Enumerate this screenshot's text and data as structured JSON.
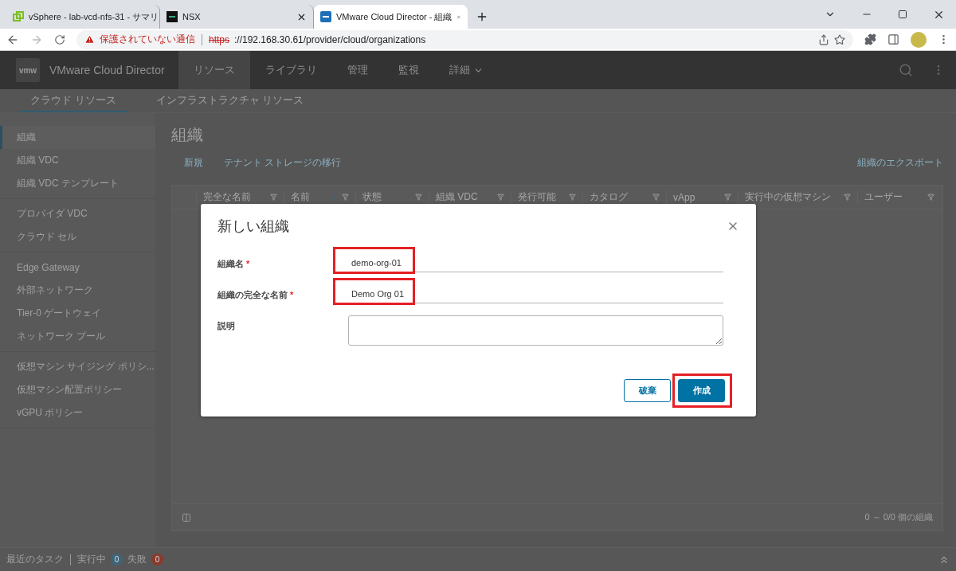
{
  "browser": {
    "tabs": [
      {
        "title": "vSphere - lab-vcd-nfs-31 - サマリ",
        "kind": "vsphere",
        "selected": false
      },
      {
        "title": "NSX",
        "kind": "nsx",
        "selected": false
      },
      {
        "title": "VMware Cloud Director - 組織",
        "kind": "vmw",
        "selected": true
      }
    ],
    "security_warning": "保護されていない通信",
    "url_scheme": "https",
    "url_rest": "://192.168.30.61/provider/cloud/organizations"
  },
  "app": {
    "logo_text": "vmw",
    "product": "VMware Cloud Director",
    "nav": [
      {
        "label": "リソース",
        "selected": true,
        "dropdown": false
      },
      {
        "label": "ライブラリ",
        "selected": false,
        "dropdown": false
      },
      {
        "label": "管理",
        "selected": false,
        "dropdown": false
      },
      {
        "label": "監視",
        "selected": false,
        "dropdown": false
      },
      {
        "label": "詳細",
        "selected": false,
        "dropdown": true
      }
    ],
    "subtabs": [
      {
        "label": "クラウド リソース",
        "selected": true
      },
      {
        "label": "インフラストラクチャ リソース",
        "selected": false
      }
    ]
  },
  "sidebar": {
    "groups": [
      {
        "items": [
          {
            "label": "組織",
            "selected": true
          },
          {
            "label": "組織 VDC",
            "selected": false
          },
          {
            "label": "組織 VDC テンプレート",
            "selected": false
          }
        ]
      },
      {
        "items": [
          {
            "label": "プロバイダ VDC",
            "selected": false
          },
          {
            "label": "クラウド セル",
            "selected": false
          }
        ]
      },
      {
        "items": [
          {
            "label": "Edge Gateway",
            "selected": false
          },
          {
            "label": "外部ネットワーク",
            "selected": false
          },
          {
            "label": "Tier-0 ゲートウェイ",
            "selected": false
          },
          {
            "label": "ネットワーク プール",
            "selected": false
          }
        ]
      },
      {
        "items": [
          {
            "label": "仮想マシン サイジング ポリシ...",
            "selected": false
          },
          {
            "label": "仮想マシン配置ポリシー",
            "selected": false
          },
          {
            "label": "vGPU ポリシー",
            "selected": false
          }
        ]
      }
    ]
  },
  "page": {
    "title": "組織",
    "actions": [
      "新規",
      "テナント ストレージの移行"
    ],
    "export": "組織のエクスポート",
    "table": {
      "columns": [
        {
          "label": "完全な名前",
          "sorted": false
        },
        {
          "label": "名前",
          "sorted": true
        },
        {
          "label": "状態",
          "sorted": false
        },
        {
          "label": "組織 VDC",
          "sorted": false
        },
        {
          "label": "発行可能",
          "sorted": false
        },
        {
          "label": "カタログ",
          "sorted": false
        },
        {
          "label": "vApp",
          "sorted": false
        },
        {
          "label": "実行中の仮想マシン",
          "sorted": false
        },
        {
          "label": "ユーザー",
          "sorted": false
        }
      ],
      "footer": "0 ～ 0/0 個の組織"
    }
  },
  "tasks": {
    "label": "最近のタスク",
    "running_label": "実行中",
    "running_count": "0",
    "failed_label": "失敗",
    "failed_count": "0"
  },
  "modal": {
    "title": "新しい組織",
    "required_mark": "*",
    "fields": [
      {
        "label": "組織名",
        "required": true,
        "value": "demo-org-01",
        "kind": "input",
        "highlighted": true
      },
      {
        "label": "組織の完全な名前",
        "required": true,
        "value": "Demo Org 01",
        "kind": "input",
        "highlighted": true
      },
      {
        "label": "説明",
        "required": false,
        "kind": "textarea",
        "highlighted": false
      }
    ],
    "buttons": [
      {
        "label": "破棄",
        "kind": "secondary",
        "highlighted": false
      },
      {
        "label": "作成",
        "kind": "primary",
        "highlighted": true
      }
    ]
  }
}
